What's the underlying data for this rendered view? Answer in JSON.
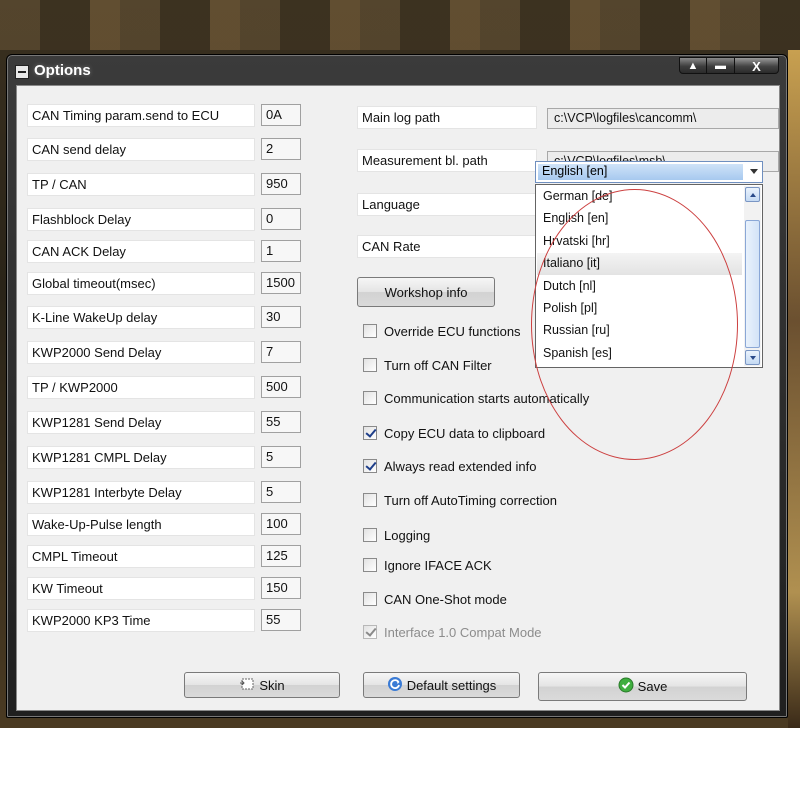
{
  "window": {
    "title": "Options",
    "minimize": "▲",
    "restore": "▬",
    "close": "X"
  },
  "params": [
    {
      "label": "CAN Timing param.send to ECU",
      "value": "0A"
    },
    {
      "label": "CAN send delay",
      "value": "2"
    },
    {
      "label": "TP / CAN",
      "value": "950"
    },
    {
      "label": "Flashblock Delay",
      "value": "0"
    },
    {
      "label": "CAN ACK Delay",
      "value": "1"
    },
    {
      "label": "Global timeout(msec)",
      "value": "1500"
    },
    {
      "label": "K-Line WakeUp delay",
      "value": "30"
    },
    {
      "label": "KWP2000 Send Delay",
      "value": "7"
    },
    {
      "label": "TP / KWP2000",
      "value": "500"
    },
    {
      "label": "KWP1281 Send Delay",
      "value": "55"
    },
    {
      "label": "KWP1281 CMPL Delay",
      "value": "5"
    },
    {
      "label": "KWP1281 Interbyte Delay",
      "value": "5"
    },
    {
      "label": "Wake-Up-Pulse length",
      "value": "100"
    },
    {
      "label": "CMPL Timeout",
      "value": "125"
    },
    {
      "label": "KW Timeout",
      "value": "150"
    },
    {
      "label": "KWP2000 KP3 Time",
      "value": "55"
    }
  ],
  "paths": {
    "main_log_label": "Main log path",
    "main_log_value": "c:\\VCP\\logfiles\\cancomm\\",
    "measurement_label": "Measurement bl. path",
    "measurement_value": "c:\\VCP\\logfiles\\msb\\"
  },
  "language": {
    "label": "Language",
    "selected": "English [en]",
    "options": [
      "German [de]",
      "English [en]",
      "Hrvatski [hr]",
      "Italiano [it]",
      "Dutch [nl]",
      "Polish [pl]",
      "Russian [ru]",
      "Spanish [es]"
    ],
    "hovered": "Italiano [it]"
  },
  "can_rate": {
    "label": "CAN Rate"
  },
  "workshop_button": "Workshop info",
  "checkboxes": [
    {
      "label": "Override ECU functions",
      "checked": false,
      "disabled": false
    },
    {
      "label": "Turn off CAN Filter",
      "checked": false,
      "disabled": false
    },
    {
      "label": "Communication starts automatically",
      "checked": false,
      "disabled": false
    },
    {
      "label": "Copy ECU data to clipboard",
      "checked": true,
      "disabled": false
    },
    {
      "label": "Always read extended info",
      "checked": true,
      "disabled": false
    },
    {
      "label": "Turn off AutoTiming correction",
      "checked": false,
      "disabled": false
    },
    {
      "label": "Logging",
      "checked": false,
      "disabled": false
    },
    {
      "label": "Ignore IFACE ACK",
      "checked": false,
      "disabled": false
    },
    {
      "label": "CAN One-Shot mode",
      "checked": false,
      "disabled": false
    },
    {
      "label": "Interface 1.0 Compat Mode",
      "checked": true,
      "disabled": true
    }
  ],
  "buttons": {
    "skin": "Skin",
    "default": "Default settings",
    "save": "Save"
  },
  "colors": {
    "annotation_circle": "#cc4040",
    "title_text": "#ffffff",
    "selected_highlight": "#a7c9ef"
  }
}
